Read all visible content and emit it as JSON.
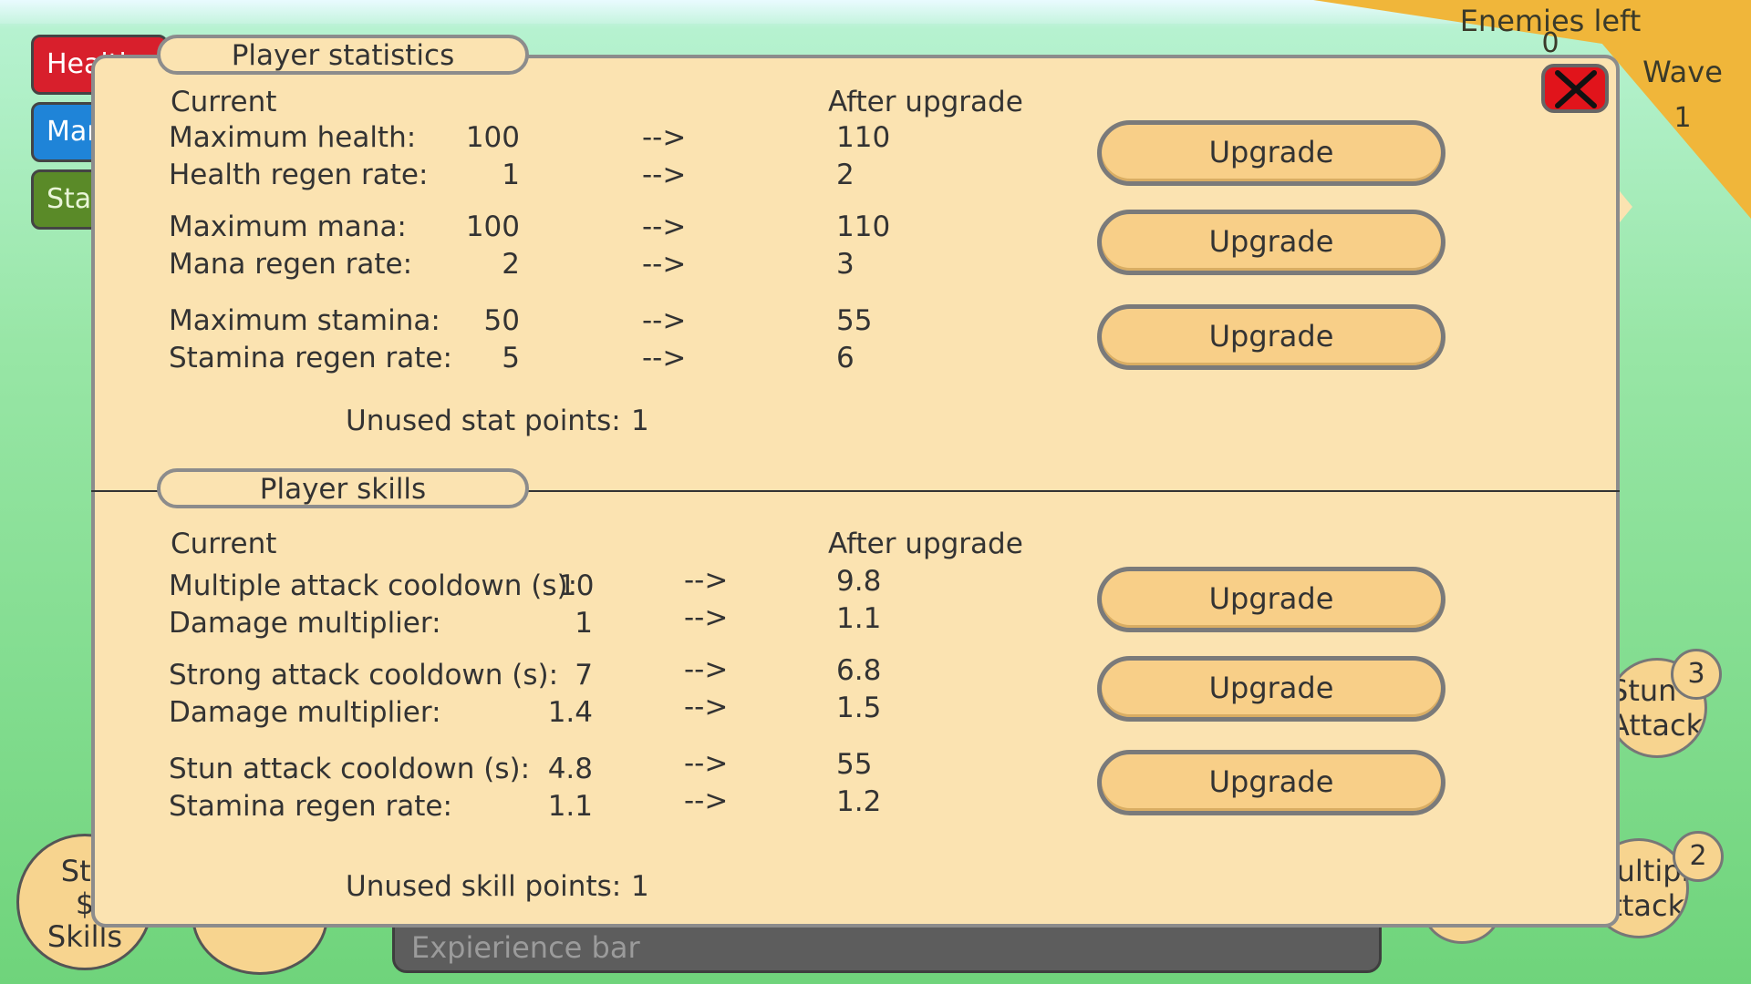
{
  "top_hud": {
    "enemies_left_label": "Enemies left",
    "enemies_left_value": "0",
    "wave_label": "Wave",
    "wave_value": "1"
  },
  "left_hud": {
    "health_label": "Health",
    "mana_label": "Mana",
    "stamina_label": "Stamina"
  },
  "bottom_hud": {
    "skills_circle_lines": [
      "Sta",
      "$",
      "Skills"
    ],
    "experience_label": "Expierience bar",
    "stun_attack": {
      "label_line1": "Stun",
      "label_line2": "Attack",
      "badge": "3"
    },
    "multiple_attack": {
      "label_line1": "Multiple",
      "label_line2": "Attack",
      "badge": "2"
    }
  },
  "colors": {
    "health": "#d81f2c",
    "mana": "#1f84d8",
    "stamina": "#5a8a28",
    "modal_bg": "#fbe3b1",
    "button": "#f8cf88",
    "close": "#e1141b",
    "banner": "#f0b63a"
  },
  "stats_panel": {
    "title": "Player statistics",
    "current_header": "Current",
    "after_header": "After upgrade",
    "arrow": "-->",
    "rows": [
      {
        "label": "Maximum health:",
        "current": "100",
        "after": "110"
      },
      {
        "label": "Health regen rate:",
        "current": "1",
        "after": "2"
      },
      {
        "label": "Maximum mana:",
        "current": "100",
        "after": "110"
      },
      {
        "label": "Mana regen rate:",
        "current": "2",
        "after": "3"
      },
      {
        "label": "Maximum stamina:",
        "current": "50",
        "after": "55"
      },
      {
        "label": "Stamina regen rate:",
        "current": "5",
        "after": "6"
      }
    ],
    "upgrade_label": "Upgrade",
    "unused_label": "Unused stat points:",
    "unused_value": "1"
  },
  "skills_panel": {
    "title": "Player skills",
    "current_header": "Current",
    "after_header": "After upgrade",
    "arrow": "-->",
    "rows": [
      {
        "label": "Multiple attack cooldown (s):",
        "current": "10",
        "after": "9.8"
      },
      {
        "label": "Damage multiplier:",
        "current": "1",
        "after": "1.1"
      },
      {
        "label": "Strong attack cooldown (s):",
        "current": "7",
        "after": "6.8"
      },
      {
        "label": "Damage multiplier:",
        "current": "1.4",
        "after": "1.5"
      },
      {
        "label": "Stun attack cooldown (s):",
        "current": "4.8",
        "after": "55"
      },
      {
        "label": "Stamina regen rate:",
        "current": "1.1",
        "after": "1.2"
      }
    ],
    "upgrade_label": "Upgrade",
    "unused_label": "Unused skill points:",
    "unused_value": "1"
  }
}
